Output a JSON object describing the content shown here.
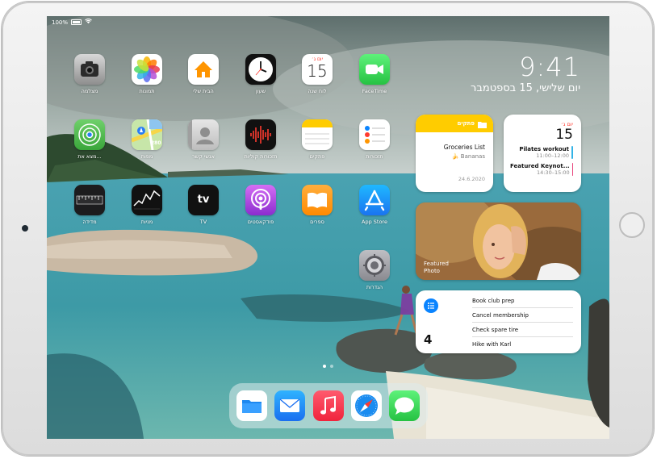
{
  "status": {
    "battery": "100%"
  },
  "clock": {
    "time": "9:41",
    "date": "יום שלישי, 15 בספטמבר"
  },
  "apps": [
    {
      "id": "camera",
      "label": "מצלמה"
    },
    {
      "id": "photos",
      "label": "תמונות"
    },
    {
      "id": "home",
      "label": "הבית שלי"
    },
    {
      "id": "clock",
      "label": "שעון"
    },
    {
      "id": "calendar",
      "label": "לוח שנה",
      "day_abbr": "יום ג׳",
      "day_num": "15"
    },
    {
      "id": "facetime",
      "label": "FaceTime"
    },
    {
      "id": "findmy",
      "label": "מצא את..."
    },
    {
      "id": "maps",
      "label": "מפות"
    },
    {
      "id": "contacts",
      "label": "אנשי קשר"
    },
    {
      "id": "voicememos",
      "label": "תזכורות קוליות"
    },
    {
      "id": "notes",
      "label": "פתקים"
    },
    {
      "id": "reminders",
      "label": "תזכורות"
    },
    {
      "id": "measure",
      "label": "מדידה"
    },
    {
      "id": "stocks",
      "label": "מניות"
    },
    {
      "id": "tv",
      "label": "TV",
      "glyph": "tv"
    },
    {
      "id": "podcasts",
      "label": "פודקאסטים"
    },
    {
      "id": "books",
      "label": "ספרים"
    },
    {
      "id": "appstore",
      "label": "App Store"
    },
    {
      "id": "settings",
      "label": "הגדרות"
    }
  ],
  "notes_widget": {
    "title": "פתקים",
    "note_title": "Groceries List",
    "note_item": "Bananas",
    "date": "24.6.2020"
  },
  "calendar_widget": {
    "day_abbr": "יום ג׳",
    "day_num": "15",
    "events": [
      {
        "title": "Pilates workout",
        "time": "11:00–12:00",
        "color": "#33b3e6"
      },
      {
        "title": "Featured Keynot...",
        "time": "14:30–15:00",
        "color": "#e8427a"
      }
    ]
  },
  "photo_widget": {
    "caption_line1": "Featured",
    "caption_line2": "Photo"
  },
  "reminders_widget": {
    "count": "4",
    "items": [
      "Book club prep",
      "Cancel membership",
      "Check spare tire",
      "Hike with Karl"
    ],
    "accent": "#0a84ff"
  },
  "dock": [
    {
      "id": "files",
      "name": "files-icon"
    },
    {
      "id": "mail",
      "name": "mail-icon"
    },
    {
      "id": "music",
      "name": "music-icon"
    },
    {
      "id": "safari",
      "name": "safari-icon"
    },
    {
      "id": "messages",
      "name": "messages-icon"
    }
  ]
}
